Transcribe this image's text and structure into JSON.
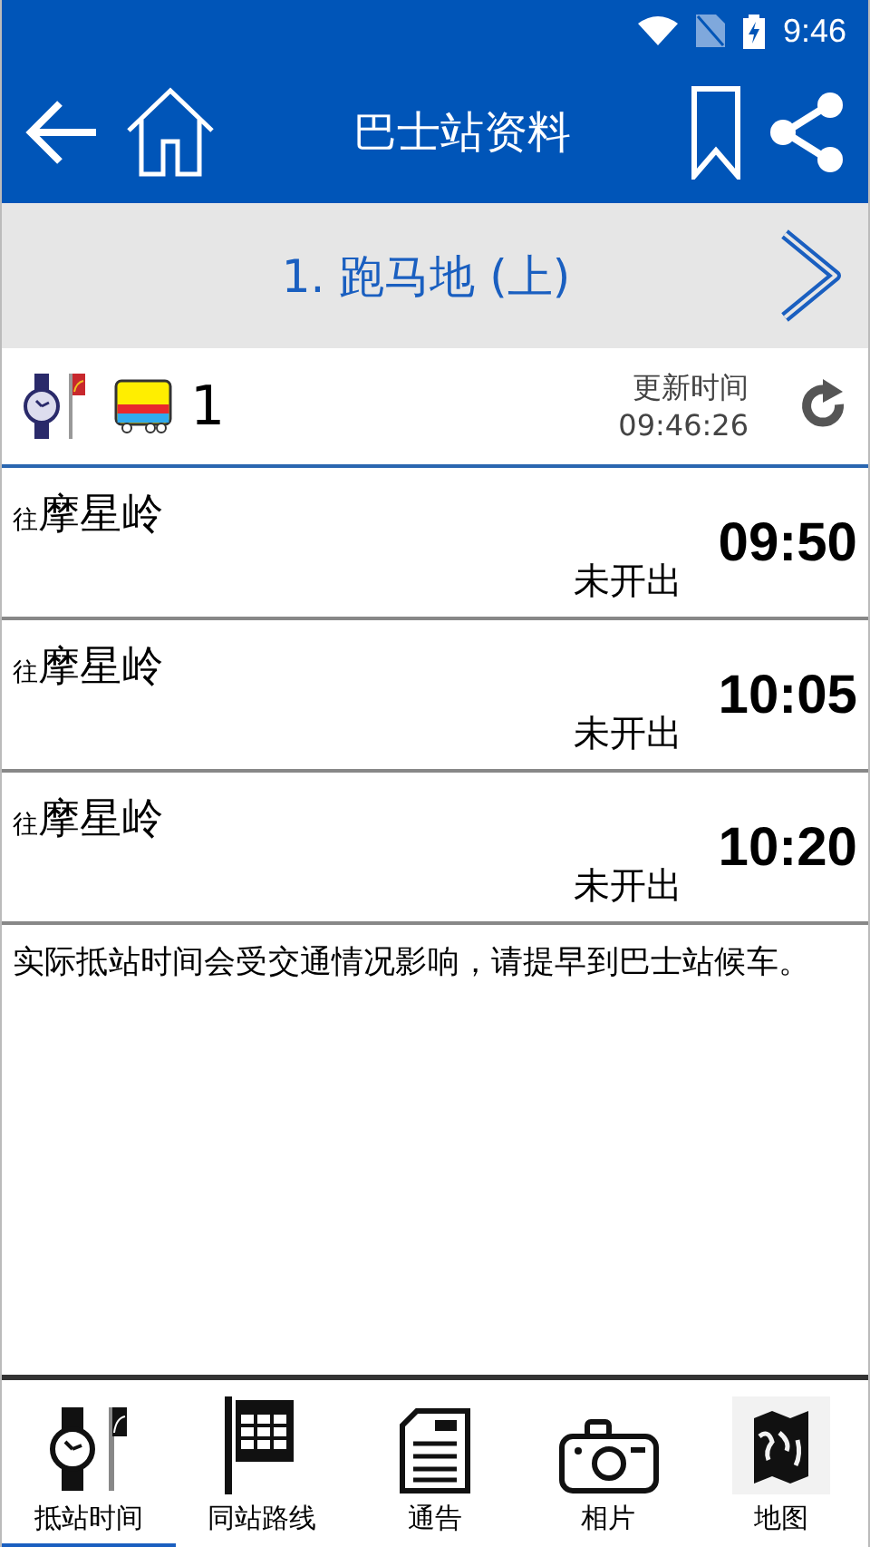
{
  "status_bar": {
    "time": "9:46"
  },
  "app_bar": {
    "title": "巴士站资料"
  },
  "stop": {
    "name": "1. 跑马地 (上)"
  },
  "route": {
    "number": "1",
    "updated_label": "更新时间",
    "updated_time": "09:46:26"
  },
  "arrivals": [
    {
      "prefix": "往",
      "destination": "摩星岭",
      "status": "未开出",
      "time": "09:50"
    },
    {
      "prefix": "往",
      "destination": "摩星岭",
      "status": "未开出",
      "time": "10:05"
    },
    {
      "prefix": "往",
      "destination": "摩星岭",
      "status": "未开出",
      "time": "10:20"
    }
  ],
  "notice": "实际抵站时间会受交通情况影响，请提早到巴士站候车。",
  "bottom_nav": [
    {
      "kind": "eta",
      "label": "抵站时间",
      "selected": true
    },
    {
      "kind": "routes",
      "label": "同站路线",
      "selected": false
    },
    {
      "kind": "notice",
      "label": "通告",
      "selected": false
    },
    {
      "kind": "photo",
      "label": "相片",
      "selected": false
    },
    {
      "kind": "map",
      "label": "地图",
      "selected": false
    }
  ]
}
